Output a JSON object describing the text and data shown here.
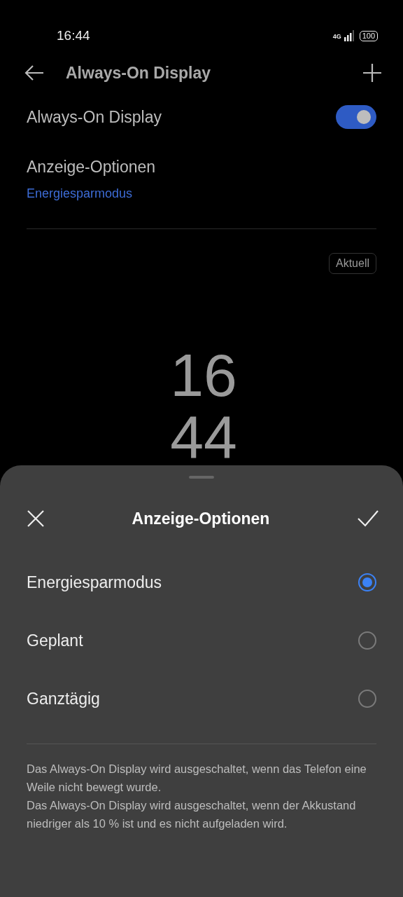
{
  "status_bar": {
    "time": "16:44",
    "network": "4G",
    "battery": "100"
  },
  "header": {
    "title": "Always-On Display"
  },
  "settings": [
    {
      "kind": "switch",
      "label": "Always-On Display",
      "on": true
    },
    {
      "kind": "option",
      "label": "Anzeige-Optionen",
      "value": "Energiesparmodus"
    }
  ],
  "preview": {
    "badge": "Aktuell",
    "clock_hours": "16",
    "clock_minutes": "44"
  },
  "sheet": {
    "title": "Anzeige-Optionen",
    "options": [
      {
        "label": "Energiesparmodus",
        "selected": true
      },
      {
        "label": "Geplant",
        "selected": false
      },
      {
        "label": "Ganztägig",
        "selected": false
      }
    ],
    "notes": [
      "Das Always-On Display wird ausgeschaltet, wenn das Telefon eine Weile nicht bewegt wurde.",
      "Das Always-On Display wird ausgeschaltet, wenn der Akkustand niedriger als 10 % ist und es nicht aufgeladen wird."
    ]
  }
}
